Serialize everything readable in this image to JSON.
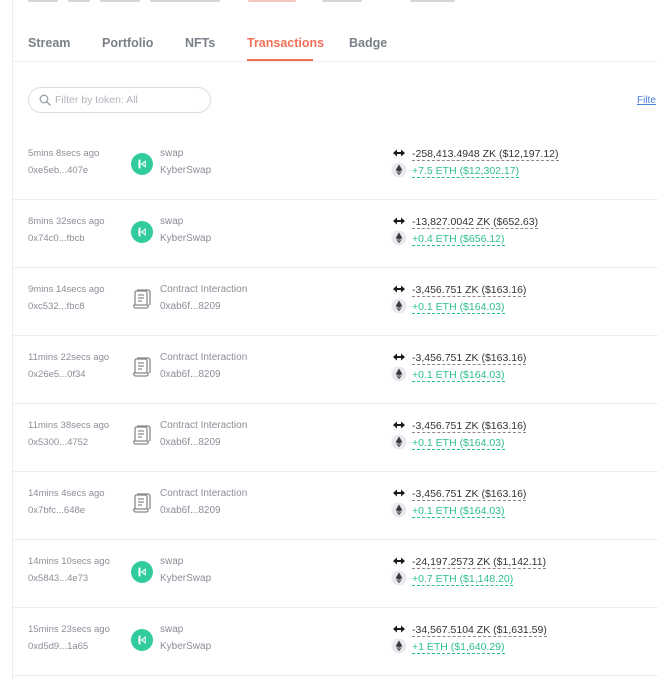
{
  "tabs": [
    "Stream",
    "Portfolio",
    "NFTs",
    "Transactions",
    "Badge"
  ],
  "active_tab": "Transactions",
  "search": {
    "placeholder": "Filter by token: All"
  },
  "filter_link": "Filte",
  "colors": {
    "accent": "#ef7058",
    "positive": "#2dbf8f",
    "kyber": "#31cb9e",
    "link": "#4c7fe0"
  },
  "icons": {
    "swap_protocol": "kyberswap-logo-icon",
    "contract": "contract-scroll-icon",
    "out_token": "zk-token-icon",
    "in_token": "eth-diamond-icon",
    "search": "search-icon"
  },
  "transactions": [
    {
      "time": "5mins 8secs ago",
      "hash": "0xe5eb...407e",
      "kind": "swap",
      "action": "swap",
      "target": "KyberSwap",
      "out": "-258,413.4948 ZK ($12,197.12)",
      "in": "+7.5 ETH ($12,302.17)"
    },
    {
      "time": "8mins 32secs ago",
      "hash": "0x74c0...fbcb",
      "kind": "swap",
      "action": "swap",
      "target": "KyberSwap",
      "out": "-13,827.0042 ZK ($652.63)",
      "in": "+0.4 ETH ($656.12)"
    },
    {
      "time": "9mins 14secs ago",
      "hash": "0xc532...fbc8",
      "kind": "contract",
      "action": "Contract Interaction",
      "target": "0xab6f...8209",
      "out": "-3,456.751 ZK ($163.16)",
      "in": "+0.1 ETH ($164.03)"
    },
    {
      "time": "11mins 22secs ago",
      "hash": "0x26e5...0f34",
      "kind": "contract",
      "action": "Contract Interaction",
      "target": "0xab6f...8209",
      "out": "-3,456.751 ZK ($163.16)",
      "in": "+0.1 ETH ($164.03)"
    },
    {
      "time": "11mins 38secs ago",
      "hash": "0x5300...4752",
      "kind": "contract",
      "action": "Contract Interaction",
      "target": "0xab6f...8209",
      "out": "-3,456.751 ZK ($163.16)",
      "in": "+0.1 ETH ($164.03)"
    },
    {
      "time": "14mins 4secs ago",
      "hash": "0x7bfc...648e",
      "kind": "contract",
      "action": "Contract Interaction",
      "target": "0xab6f...8209",
      "out": "-3,456.751 ZK ($163.16)",
      "in": "+0.1 ETH ($164.03)"
    },
    {
      "time": "14mins 10secs ago",
      "hash": "0x5843...4e73",
      "kind": "swap",
      "action": "swap",
      "target": "KyberSwap",
      "out": "-24,197.2573 ZK ($1,142.11)",
      "in": "+0.7 ETH ($1,148.20)"
    },
    {
      "time": "15mins 23secs ago",
      "hash": "0xd5d9...1a65",
      "kind": "swap",
      "action": "swap",
      "target": "KyberSwap",
      "out": "-34,567.5104 ZK ($1,631.59)",
      "in": "+1 ETH ($1,640.29)"
    }
  ]
}
